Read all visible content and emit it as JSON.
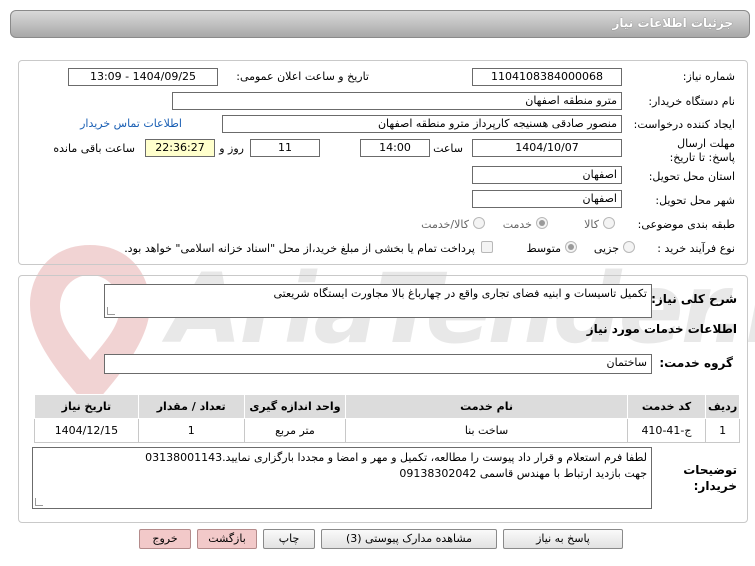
{
  "header": {
    "title": "جزئیات اطلاعات نیاز"
  },
  "fields": {
    "need_number_label": "شماره نیاز:",
    "need_number": "1104108384000068",
    "announce_label": "تاریخ و ساعت اعلان عمومی:",
    "announce_value": "1404/09/25 - 13:09",
    "buyer_org_label": "نام دستگاه خریدار:",
    "buyer_org": "مترو منطقه اصفهان",
    "creator_label": "ایجاد کننده درخواست:",
    "creator": "منصور صادقی هسنیجه کارپرداز مترو منطقه اصفهان",
    "contact_link": "اطلاعات تماس خریدار",
    "deadline_label": "مهلت ارسال پاسخ: تا تاریخ:",
    "deadline_date": "1404/10/07",
    "time_label": "ساعت",
    "deadline_time": "14:00",
    "days_value": "11",
    "days_label": "روز و",
    "remaining_time": "22:36:27",
    "remaining_label": "ساعت باقی مانده",
    "province_label": "استان محل تحویل:",
    "province": "اصفهان",
    "city_label": "شهر محل تحویل:",
    "city": "اصفهان",
    "category_label": "طبقه بندی موضوعی:",
    "category_options": [
      "کالا",
      "خدمت",
      "کالا/خدمت"
    ],
    "category_selected": "خدمت",
    "process_label": "نوع فرآیند خرید :",
    "process_options": [
      "جزیی",
      "متوسط"
    ],
    "process_selected": "متوسط",
    "payment_note": "پرداخت تمام یا بخشی از مبلغ خرید،از محل \"اسناد خزانه اسلامی\" خواهد بود."
  },
  "description": {
    "label": "شرح کلی نیاز:",
    "text": "تکمیل تاسیسات و  ابنیه فضای تجاری واقع در چهارباغ بالا مجاورت ایستگاه شریعتی"
  },
  "services": {
    "section_title": "اطلاعات خدمات مورد نیاز",
    "group_label": "گروه خدمت:",
    "group_value": "ساختمان",
    "columns": [
      "ردیف",
      "کد خدمت",
      "نام خدمت",
      "واحد اندازه گیری",
      "تعداد / مقدار",
      "تاریخ نیاز"
    ],
    "rows": [
      [
        "1",
        "ج-41-410",
        "ساخت بنا",
        "متر مربع",
        "1",
        "1404/12/15"
      ]
    ]
  },
  "buyer_notes": {
    "label": "توضیحات خریدار:",
    "line1": "لطفا فرم استعلام و قرار داد پیوست را مطالعه، تکمیل و مهر و امضا و مجددا بارگزاری نمایید.03138001143",
    "line2": "جهت بازدید ارتباط با مهندس قاسمی 09138302042"
  },
  "buttons": {
    "reply": "پاسخ به نیاز",
    "attachments": "مشاهده مدارک پیوستی (3)",
    "print": "چاپ",
    "back": "بازگشت",
    "exit": "خروج"
  },
  "watermark": {
    "text": "AriaTender.net"
  },
  "colors": {
    "link": "#1a5fb4",
    "remaining_bg": "#ffffcc",
    "header_bg": "#bdbdbd",
    "table_header": "#dcdcdc"
  }
}
